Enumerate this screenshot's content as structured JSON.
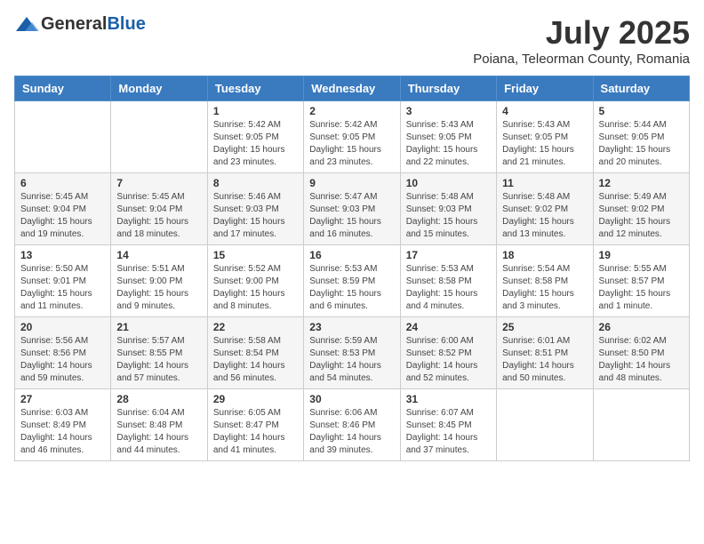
{
  "logo": {
    "general": "General",
    "blue": "Blue"
  },
  "title": "July 2025",
  "subtitle": "Poiana, Teleorman County, Romania",
  "days_of_week": [
    "Sunday",
    "Monday",
    "Tuesday",
    "Wednesday",
    "Thursday",
    "Friday",
    "Saturday"
  ],
  "weeks": [
    [
      {
        "day": "",
        "info": ""
      },
      {
        "day": "",
        "info": ""
      },
      {
        "day": "1",
        "info": "Sunrise: 5:42 AM\nSunset: 9:05 PM\nDaylight: 15 hours and 23 minutes."
      },
      {
        "day": "2",
        "info": "Sunrise: 5:42 AM\nSunset: 9:05 PM\nDaylight: 15 hours and 23 minutes."
      },
      {
        "day": "3",
        "info": "Sunrise: 5:43 AM\nSunset: 9:05 PM\nDaylight: 15 hours and 22 minutes."
      },
      {
        "day": "4",
        "info": "Sunrise: 5:43 AM\nSunset: 9:05 PM\nDaylight: 15 hours and 21 minutes."
      },
      {
        "day": "5",
        "info": "Sunrise: 5:44 AM\nSunset: 9:05 PM\nDaylight: 15 hours and 20 minutes."
      }
    ],
    [
      {
        "day": "6",
        "info": "Sunrise: 5:45 AM\nSunset: 9:04 PM\nDaylight: 15 hours and 19 minutes."
      },
      {
        "day": "7",
        "info": "Sunrise: 5:45 AM\nSunset: 9:04 PM\nDaylight: 15 hours and 18 minutes."
      },
      {
        "day": "8",
        "info": "Sunrise: 5:46 AM\nSunset: 9:03 PM\nDaylight: 15 hours and 17 minutes."
      },
      {
        "day": "9",
        "info": "Sunrise: 5:47 AM\nSunset: 9:03 PM\nDaylight: 15 hours and 16 minutes."
      },
      {
        "day": "10",
        "info": "Sunrise: 5:48 AM\nSunset: 9:03 PM\nDaylight: 15 hours and 15 minutes."
      },
      {
        "day": "11",
        "info": "Sunrise: 5:48 AM\nSunset: 9:02 PM\nDaylight: 15 hours and 13 minutes."
      },
      {
        "day": "12",
        "info": "Sunrise: 5:49 AM\nSunset: 9:02 PM\nDaylight: 15 hours and 12 minutes."
      }
    ],
    [
      {
        "day": "13",
        "info": "Sunrise: 5:50 AM\nSunset: 9:01 PM\nDaylight: 15 hours and 11 minutes."
      },
      {
        "day": "14",
        "info": "Sunrise: 5:51 AM\nSunset: 9:00 PM\nDaylight: 15 hours and 9 minutes."
      },
      {
        "day": "15",
        "info": "Sunrise: 5:52 AM\nSunset: 9:00 PM\nDaylight: 15 hours and 8 minutes."
      },
      {
        "day": "16",
        "info": "Sunrise: 5:53 AM\nSunset: 8:59 PM\nDaylight: 15 hours and 6 minutes."
      },
      {
        "day": "17",
        "info": "Sunrise: 5:53 AM\nSunset: 8:58 PM\nDaylight: 15 hours and 4 minutes."
      },
      {
        "day": "18",
        "info": "Sunrise: 5:54 AM\nSunset: 8:58 PM\nDaylight: 15 hours and 3 minutes."
      },
      {
        "day": "19",
        "info": "Sunrise: 5:55 AM\nSunset: 8:57 PM\nDaylight: 15 hours and 1 minute."
      }
    ],
    [
      {
        "day": "20",
        "info": "Sunrise: 5:56 AM\nSunset: 8:56 PM\nDaylight: 14 hours and 59 minutes."
      },
      {
        "day": "21",
        "info": "Sunrise: 5:57 AM\nSunset: 8:55 PM\nDaylight: 14 hours and 57 minutes."
      },
      {
        "day": "22",
        "info": "Sunrise: 5:58 AM\nSunset: 8:54 PM\nDaylight: 14 hours and 56 minutes."
      },
      {
        "day": "23",
        "info": "Sunrise: 5:59 AM\nSunset: 8:53 PM\nDaylight: 14 hours and 54 minutes."
      },
      {
        "day": "24",
        "info": "Sunrise: 6:00 AM\nSunset: 8:52 PM\nDaylight: 14 hours and 52 minutes."
      },
      {
        "day": "25",
        "info": "Sunrise: 6:01 AM\nSunset: 8:51 PM\nDaylight: 14 hours and 50 minutes."
      },
      {
        "day": "26",
        "info": "Sunrise: 6:02 AM\nSunset: 8:50 PM\nDaylight: 14 hours and 48 minutes."
      }
    ],
    [
      {
        "day": "27",
        "info": "Sunrise: 6:03 AM\nSunset: 8:49 PM\nDaylight: 14 hours and 46 minutes."
      },
      {
        "day": "28",
        "info": "Sunrise: 6:04 AM\nSunset: 8:48 PM\nDaylight: 14 hours and 44 minutes."
      },
      {
        "day": "29",
        "info": "Sunrise: 6:05 AM\nSunset: 8:47 PM\nDaylight: 14 hours and 41 minutes."
      },
      {
        "day": "30",
        "info": "Sunrise: 6:06 AM\nSunset: 8:46 PM\nDaylight: 14 hours and 39 minutes."
      },
      {
        "day": "31",
        "info": "Sunrise: 6:07 AM\nSunset: 8:45 PM\nDaylight: 14 hours and 37 minutes."
      },
      {
        "day": "",
        "info": ""
      },
      {
        "day": "",
        "info": ""
      }
    ]
  ]
}
